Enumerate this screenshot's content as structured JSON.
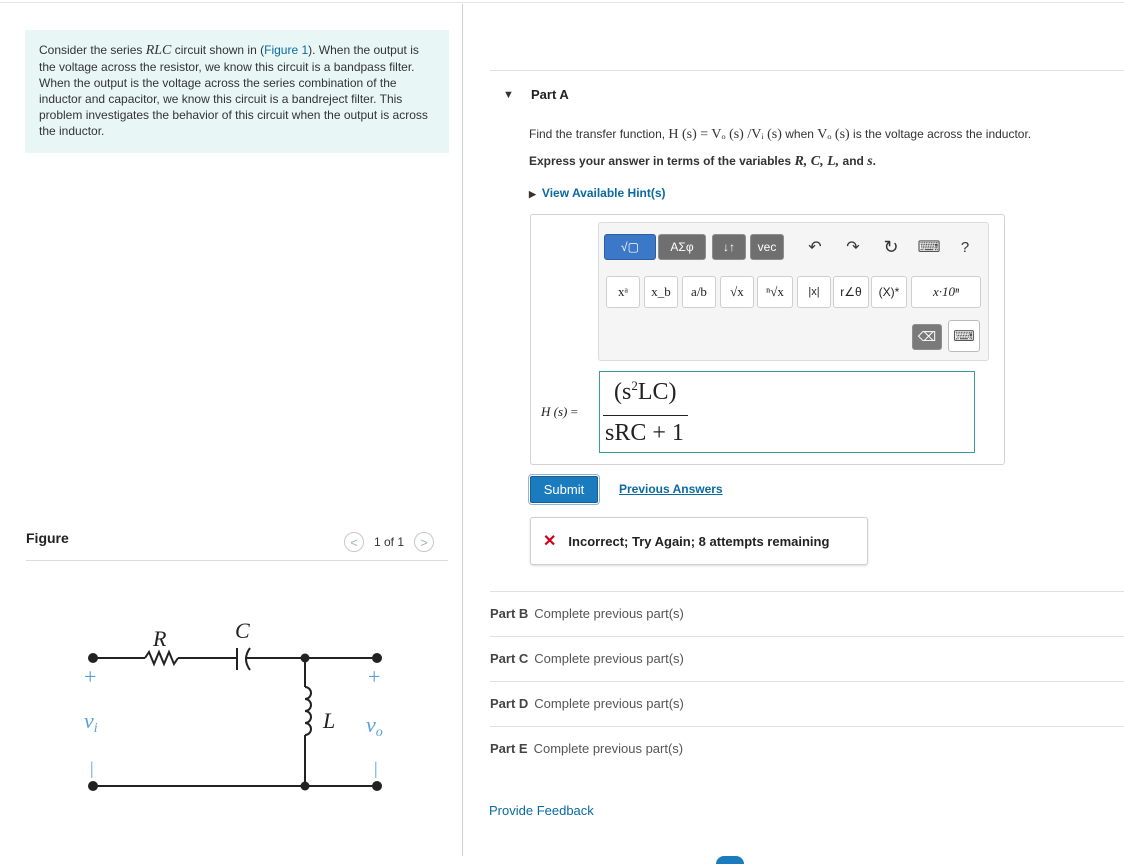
{
  "intro": {
    "t1": "Consider the series ",
    "math": "RLC",
    "t2": " circuit shown in (",
    "figure_link": "Figure 1",
    "t3": "). When the output is the voltage across the resistor, we know this circuit is a bandpass filter. When the output is the voltage across the series combination of the inductor and capacitor, we know this circuit is a bandreject filter. This problem investigates the behavior of this circuit when the output is across the inductor."
  },
  "figure": {
    "label": "Figure",
    "pager": "1 of 1",
    "prev_glyph": "<",
    "next_glyph": ">",
    "circuit": {
      "R": "R",
      "C": "C",
      "L": "L",
      "vi": "v",
      "vi_sub": "i",
      "vo": "v",
      "vo_sub": "o",
      "plus": "+",
      "minus": "|"
    }
  },
  "partA": {
    "arrow": "▼",
    "title": "Part A",
    "q1_a": "Find the transfer function, ",
    "q1_math": "H (s) = Vₒ (s) /Vᵢ (s)",
    "q1_b": " when ",
    "q1_math2": "Vₒ (s)",
    "q1_c": " is the voltage across the inductor.",
    "q2_a": "Express your answer in terms of the variables ",
    "q2_vars": "R, C, L,",
    "q2_b": " and ",
    "q2_s": "s",
    "q2_end": ".",
    "hints_arrow": "▶",
    "hints": "View Available Hint(s)"
  },
  "toolbar": {
    "templates": "√▢",
    "greek": "ΑΣφ",
    "updown": "↓↑",
    "vec": "vec",
    "undo": "↶",
    "redo": "↷",
    "reset": "↻",
    "keyboard": "⌨",
    "help": "?",
    "math_buttons": [
      "xᵃ",
      "x_b",
      "a/b",
      "√x",
      "ⁿ√x",
      "|x|",
      "r∠θ",
      "(X)*",
      "x·10ⁿ"
    ],
    "backspace": "⌫"
  },
  "answer": {
    "label": "H (s)",
    "equals": " =",
    "num_a": "(s",
    "num_sup": "2",
    "num_b": "LC)",
    "den": "sRC + 1"
  },
  "actions": {
    "submit": "Submit",
    "previous": "Previous Answers"
  },
  "feedback": {
    "icon": "✕",
    "text": "Incorrect; Try Again; 8 attempts remaining"
  },
  "parts": [
    {
      "label": "Part B",
      "status": "Complete previous part(s)"
    },
    {
      "label": "Part C",
      "status": "Complete previous part(s)"
    },
    {
      "label": "Part D",
      "status": "Complete previous part(s)"
    },
    {
      "label": "Part E",
      "status": "Complete previous part(s)"
    }
  ],
  "provide_feedback": "Provide Feedback"
}
